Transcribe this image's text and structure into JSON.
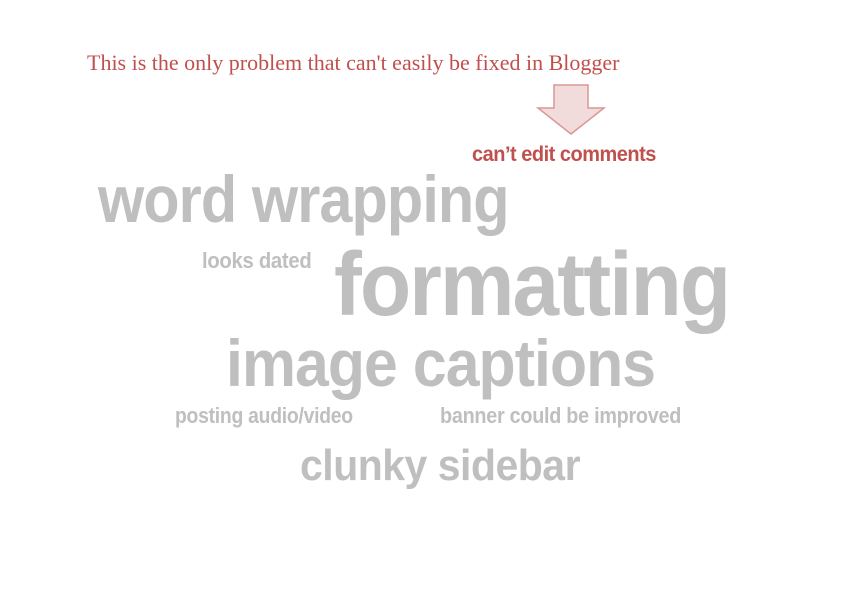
{
  "note": {
    "text": "This is the only problem that can't easily be fixed in Blogger"
  },
  "arrow": {
    "icon": "down-arrow-icon",
    "fill_color": "#f2dcdb",
    "stroke_color": "#d99694"
  },
  "colors": {
    "highlight": "#c0504d",
    "cloud_word": "#bfbfbf"
  },
  "word_cloud": {
    "cant_edit_comments": "can’t edit comments",
    "word_wrapping": "word wrapping",
    "looks_dated": "looks dated",
    "formatting": "formatting",
    "image_captions": "image captions",
    "posting_audio_video": "posting audio/video",
    "banner_could_be_improved": "banner could be improved",
    "clunky_sidebar": "clunky sidebar"
  }
}
